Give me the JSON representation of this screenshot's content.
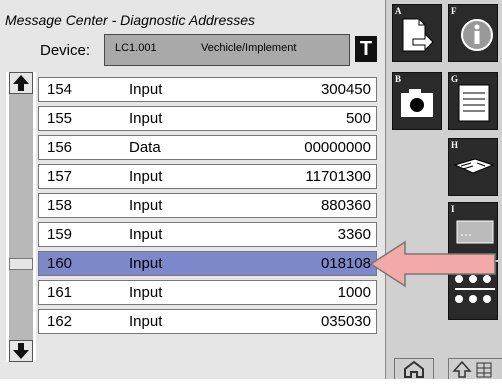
{
  "header": {
    "title": "Message Center - Diagnostic Addresses",
    "device_label": "Device:",
    "device_code": "LC1.001",
    "device_desc": "Vechicle/Implement",
    "t_button": "T"
  },
  "rows": [
    {
      "addr": "154",
      "type": "Input",
      "value": "300450"
    },
    {
      "addr": "155",
      "type": "Input",
      "value": "500"
    },
    {
      "addr": "156",
      "type": "Data",
      "value": "00000000"
    },
    {
      "addr": "157",
      "type": "Input",
      "value": "11701300"
    },
    {
      "addr": "158",
      "type": "Input",
      "value": "880360"
    },
    {
      "addr": "159",
      "type": "Input",
      "value": "3360"
    },
    {
      "addr": "160",
      "type": "Input",
      "value": "018108"
    },
    {
      "addr": "161",
      "type": "Input",
      "value": "1000"
    },
    {
      "addr": "162",
      "type": "Input",
      "value": "035030"
    }
  ],
  "selected_row": "160",
  "sidebar": {
    "buttons": [
      {
        "key": "A",
        "icon": "document-arrow-icon"
      },
      {
        "key": "F",
        "icon": "info-icon"
      },
      {
        "key": "B",
        "icon": "camera-icon"
      },
      {
        "key": "G",
        "icon": "list-document-icon"
      },
      {
        "key": "H",
        "icon": "manual-icon"
      },
      {
        "key": "I",
        "icon": "controller-box-icon"
      },
      {
        "key": "J",
        "icon": "network-icon"
      }
    ]
  },
  "colors": {
    "selected_row": "#7e89cc",
    "annotation_arrow": "#f4a9a9"
  }
}
